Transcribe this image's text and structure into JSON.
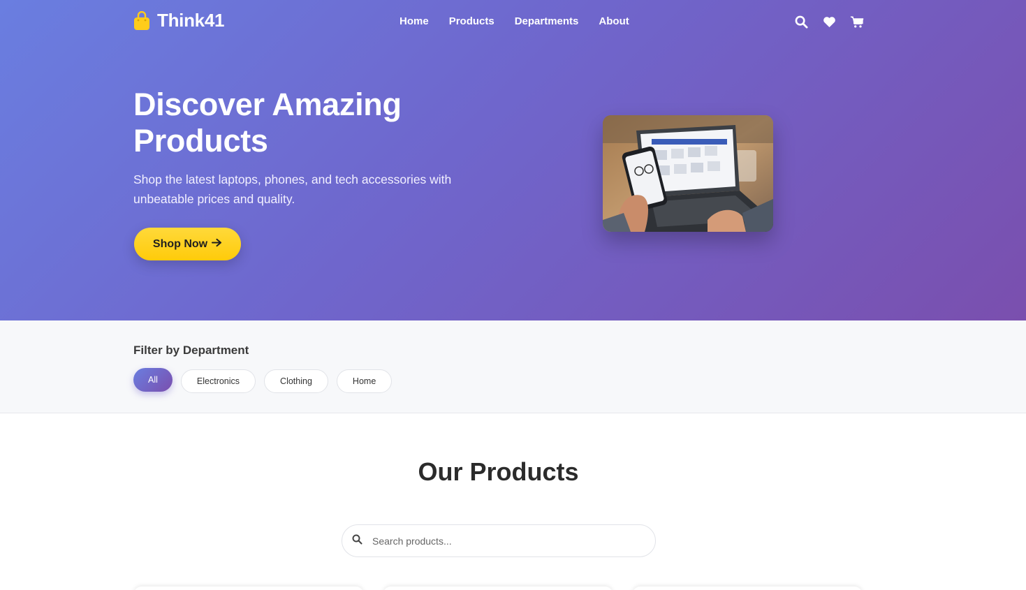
{
  "brand": {
    "name": "Think41",
    "icon": "shopping-bag-icon",
    "icon_color": "#ffcc1a"
  },
  "nav": {
    "links": [
      {
        "label": "Home"
      },
      {
        "label": "Products"
      },
      {
        "label": "Departments"
      },
      {
        "label": "About"
      }
    ],
    "icons": [
      "search-icon",
      "heart-icon",
      "cart-icon"
    ]
  },
  "hero": {
    "title": "Discover Amazing Products",
    "subtitle": "Shop the latest laptops, phones, and tech accessories with unbeatable prices and quality.",
    "cta_label": "Shop Now",
    "cta_icon": "arrow-right-icon",
    "gradient_start": "#6a7ee0",
    "gradient_end": "#7a4fae",
    "cta_color": "#ffd21e"
  },
  "filter": {
    "title": "Filter by Department",
    "departments": [
      {
        "label": "All",
        "active": true
      },
      {
        "label": "Electronics",
        "active": false
      },
      {
        "label": "Clothing",
        "active": false
      },
      {
        "label": "Home",
        "active": false
      }
    ]
  },
  "products": {
    "title": "Our Products",
    "search_placeholder": "Search products..."
  }
}
